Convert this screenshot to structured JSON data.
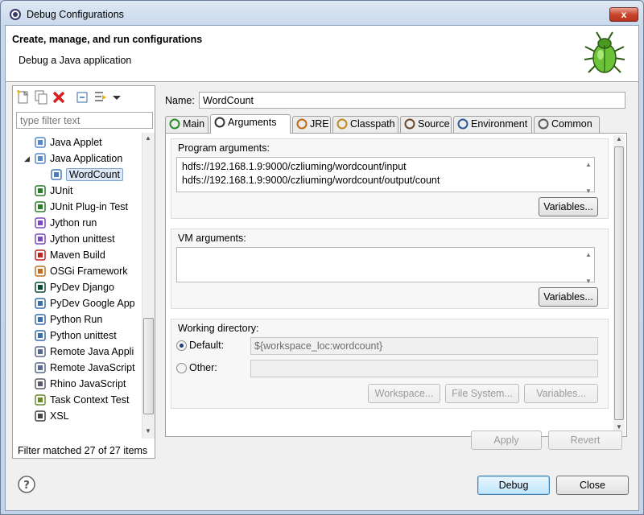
{
  "window": {
    "title": "Debug Configurations",
    "close_label": "x"
  },
  "header": {
    "title": "Create, manage, and run configurations",
    "subtitle": "Debug a Java application"
  },
  "left": {
    "filter_placeholder": "type filter text",
    "tree": [
      {
        "label": "Java Applet",
        "icon": "java-applet-icon",
        "level": 1
      },
      {
        "label": "Java Application",
        "icon": "java-application-icon",
        "level": 1,
        "expanded": true
      },
      {
        "label": "WordCount",
        "icon": "java-class-icon",
        "level": 2,
        "selected": true
      },
      {
        "label": "JUnit",
        "icon": "junit-icon",
        "level": 1
      },
      {
        "label": "JUnit Plug-in Test",
        "icon": "junit-plugin-icon",
        "level": 1
      },
      {
        "label": "Jython run",
        "icon": "jython-icon",
        "level": 1
      },
      {
        "label": "Jython unittest",
        "icon": "jython-unittest-icon",
        "level": 1
      },
      {
        "label": "Maven Build",
        "icon": "maven-icon",
        "level": 1
      },
      {
        "label": "OSGi Framework",
        "icon": "osgi-icon",
        "level": 1
      },
      {
        "label": "PyDev Django",
        "icon": "django-icon",
        "level": 1
      },
      {
        "label": "PyDev Google App",
        "icon": "python-icon",
        "level": 1
      },
      {
        "label": "Python Run",
        "icon": "python-run-icon",
        "level": 1
      },
      {
        "label": "Python unittest",
        "icon": "python-unittest-icon",
        "level": 1
      },
      {
        "label": "Remote Java Appli",
        "icon": "remote-java-icon",
        "level": 1
      },
      {
        "label": "Remote JavaScript",
        "icon": "remote-javascript-icon",
        "level": 1
      },
      {
        "label": "Rhino JavaScript",
        "icon": "rhino-icon",
        "level": 1
      },
      {
        "label": "Task Context Test",
        "icon": "task-context-icon",
        "level": 1
      },
      {
        "label": "XSL",
        "icon": "xsl-icon",
        "level": 1
      }
    ],
    "filter_status": "Filter matched 27 of 27 items"
  },
  "right": {
    "name_label": "Name:",
    "name_value": "WordCount",
    "tabs": [
      {
        "label": "Main",
        "icon": "main-tab-icon"
      },
      {
        "label": "Arguments",
        "icon": "arguments-tab-icon",
        "active": true
      },
      {
        "label": "JRE",
        "icon": "jre-tab-icon"
      },
      {
        "label": "Classpath",
        "icon": "classpath-tab-icon"
      },
      {
        "label": "Source",
        "icon": "source-tab-icon"
      },
      {
        "label": "Environment",
        "icon": "environment-tab-icon"
      },
      {
        "label": "Common",
        "icon": "common-tab-icon"
      }
    ],
    "program_args_label": "Program arguments:",
    "program_args": [
      "hdfs://192.168.1.9:9000/czliuming/wordcount/input",
      "hdfs://192.168.1.9:9000/czliuming/wordcount/output/count"
    ],
    "variables_label": "Variables...",
    "vm_args_label": "VM arguments:",
    "vm_args": "",
    "workdir_label": "Working directory:",
    "default_label": "Default:",
    "default_value": "${workspace_loc:wordcount}",
    "other_label": "Other:",
    "other_value": "",
    "workspace_label": "Workspace...",
    "filesystem_label": "File System...",
    "variables2_label": "Variables..."
  },
  "footer": {
    "apply_label": "Apply",
    "revert_label": "Revert",
    "debug_label": "Debug",
    "close_label": "Close"
  }
}
